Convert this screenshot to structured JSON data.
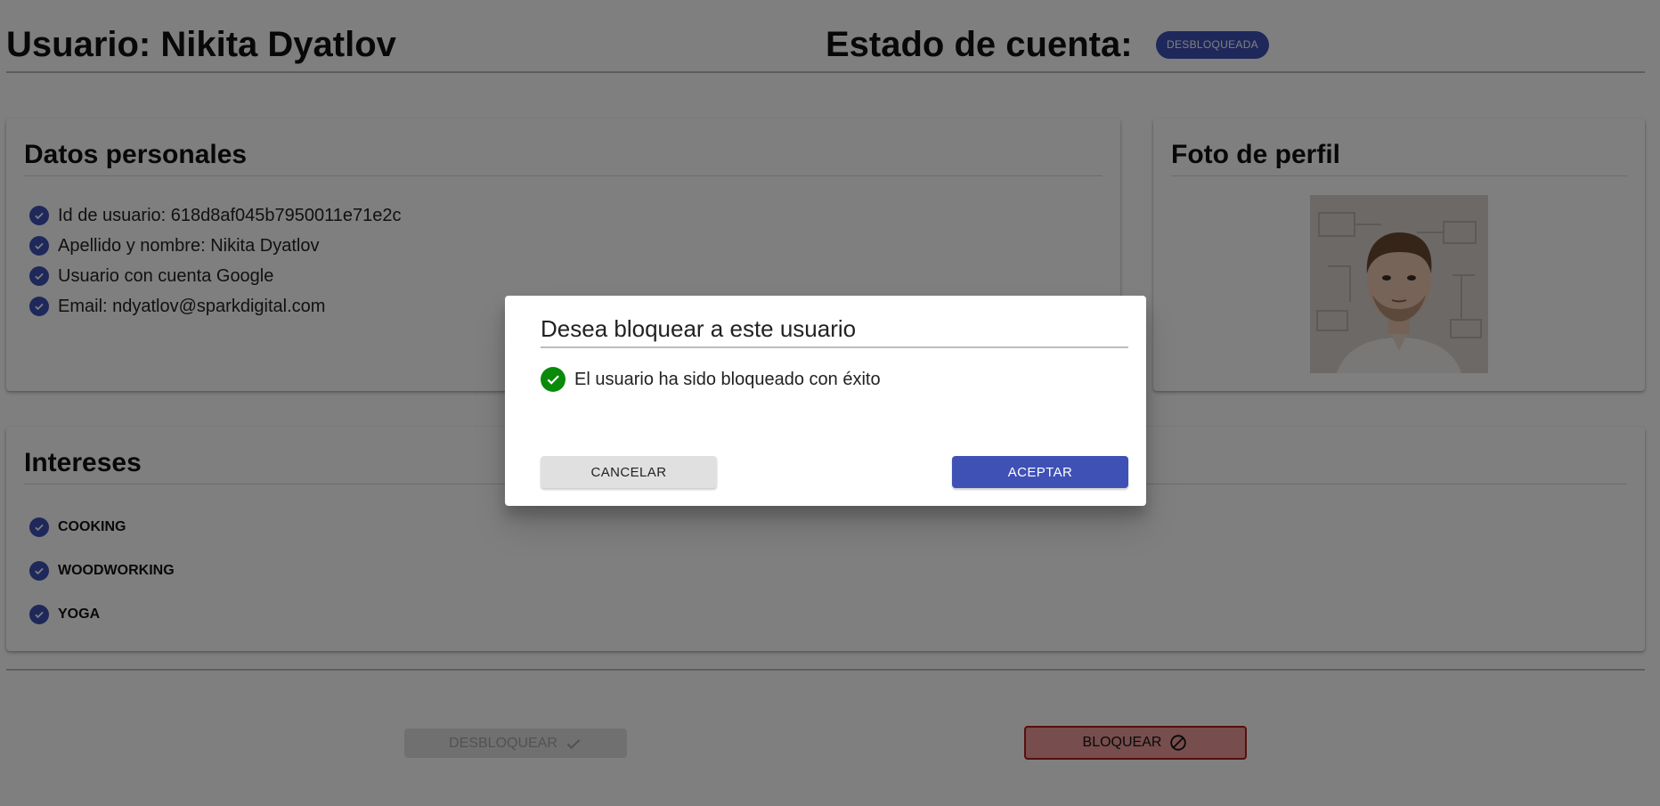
{
  "header": {
    "user_title": "Usuario: Nikita Dyatlov",
    "status_title": "Estado de cuenta:",
    "status_chip": "DESBLOQUEADA"
  },
  "personal": {
    "title": "Datos personales",
    "items": [
      "Id de usuario: 618d8af045b7950011e71e2c",
      "Apellido y nombre: Nikita Dyatlov",
      "Usuario con cuenta Google",
      "Email: ndyatlov@sparkdigital.com"
    ]
  },
  "photo": {
    "title": "Foto de perfil"
  },
  "interests": {
    "title": "Intereses",
    "items": [
      "COOKING",
      "WOODWORKING",
      "YOGA"
    ]
  },
  "actions": {
    "unblock_label": "DESBLOQUEAR",
    "block_label": "BLOQUEAR"
  },
  "dialog": {
    "title": "Desea bloquear a este usuario",
    "message": "El usuario ha sido bloqueado con éxito",
    "cancel_label": "CANCELAR",
    "accept_label": "ACEPTAR"
  },
  "colors": {
    "primary": "#3f51b5",
    "success": "#0a8a0a",
    "danger": "#b71c1c",
    "danger_bg": "#ef9a9a"
  },
  "icons": {
    "list_check": "check-circle-icon",
    "success": "check-circle-filled-icon",
    "unblock": "check-icon",
    "block": "block-icon"
  }
}
